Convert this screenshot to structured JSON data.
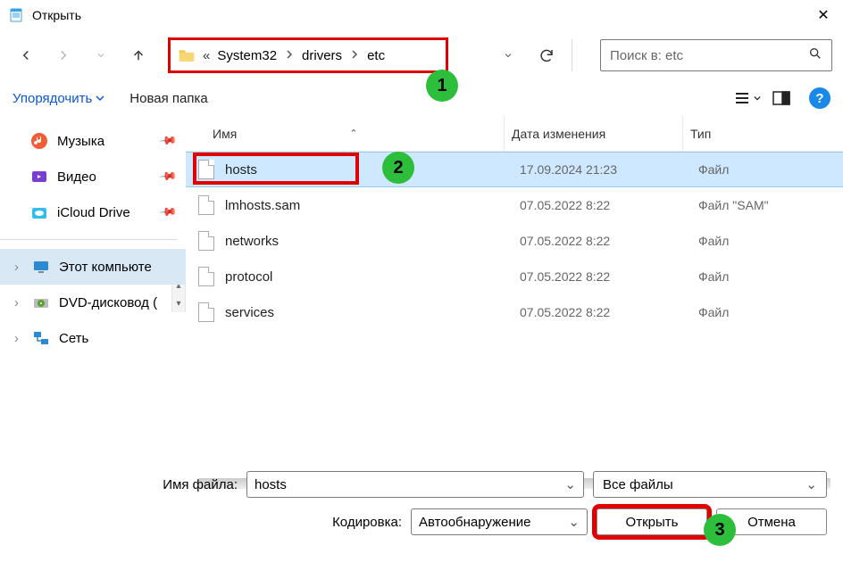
{
  "title": "Открыть",
  "breadcrumb": {
    "prefix": "«",
    "parts": [
      "System32",
      "drivers",
      "etc"
    ]
  },
  "search": {
    "placeholder": "Поиск в: etc"
  },
  "org": {
    "organize": "Упорядочить",
    "newfolder": "Новая папка"
  },
  "sidebar": {
    "quick": [
      {
        "label": "Музыка",
        "icon": "music",
        "pinned": true
      },
      {
        "label": "Видео",
        "icon": "video",
        "pinned": true
      },
      {
        "label": "iCloud Drive",
        "icon": "icloud",
        "pinned": true
      }
    ],
    "tree": [
      {
        "label": "Этот компьюте",
        "icon": "pc",
        "selected": true
      },
      {
        "label": "DVD-дисковод (",
        "icon": "dvd"
      },
      {
        "label": "Сеть",
        "icon": "network"
      }
    ]
  },
  "columns": {
    "name": "Имя",
    "date": "Дата изменения",
    "type": "Тип"
  },
  "files": [
    {
      "name": "hosts",
      "date": "17.09.2024 21:23",
      "type": "Файл",
      "selected": true,
      "highlight": true
    },
    {
      "name": "lmhosts.sam",
      "date": "07.05.2022 8:22",
      "type": "Файл \"SAM\""
    },
    {
      "name": "networks",
      "date": "07.05.2022 8:22",
      "type": "Файл"
    },
    {
      "name": "protocol",
      "date": "07.05.2022 8:22",
      "type": "Файл"
    },
    {
      "name": "services",
      "date": "07.05.2022 8:22",
      "type": "Файл"
    }
  ],
  "form": {
    "filename_label": "Имя файла:",
    "filename_value": "hosts",
    "filter_value": "Все файлы",
    "encoding_label": "Кодировка:",
    "encoding_value": "Автообнаружение",
    "open": "Открыть",
    "cancel": "Отмена"
  },
  "badges": {
    "a": "1",
    "b": "2",
    "c": "3"
  },
  "help_glyph": "?"
}
